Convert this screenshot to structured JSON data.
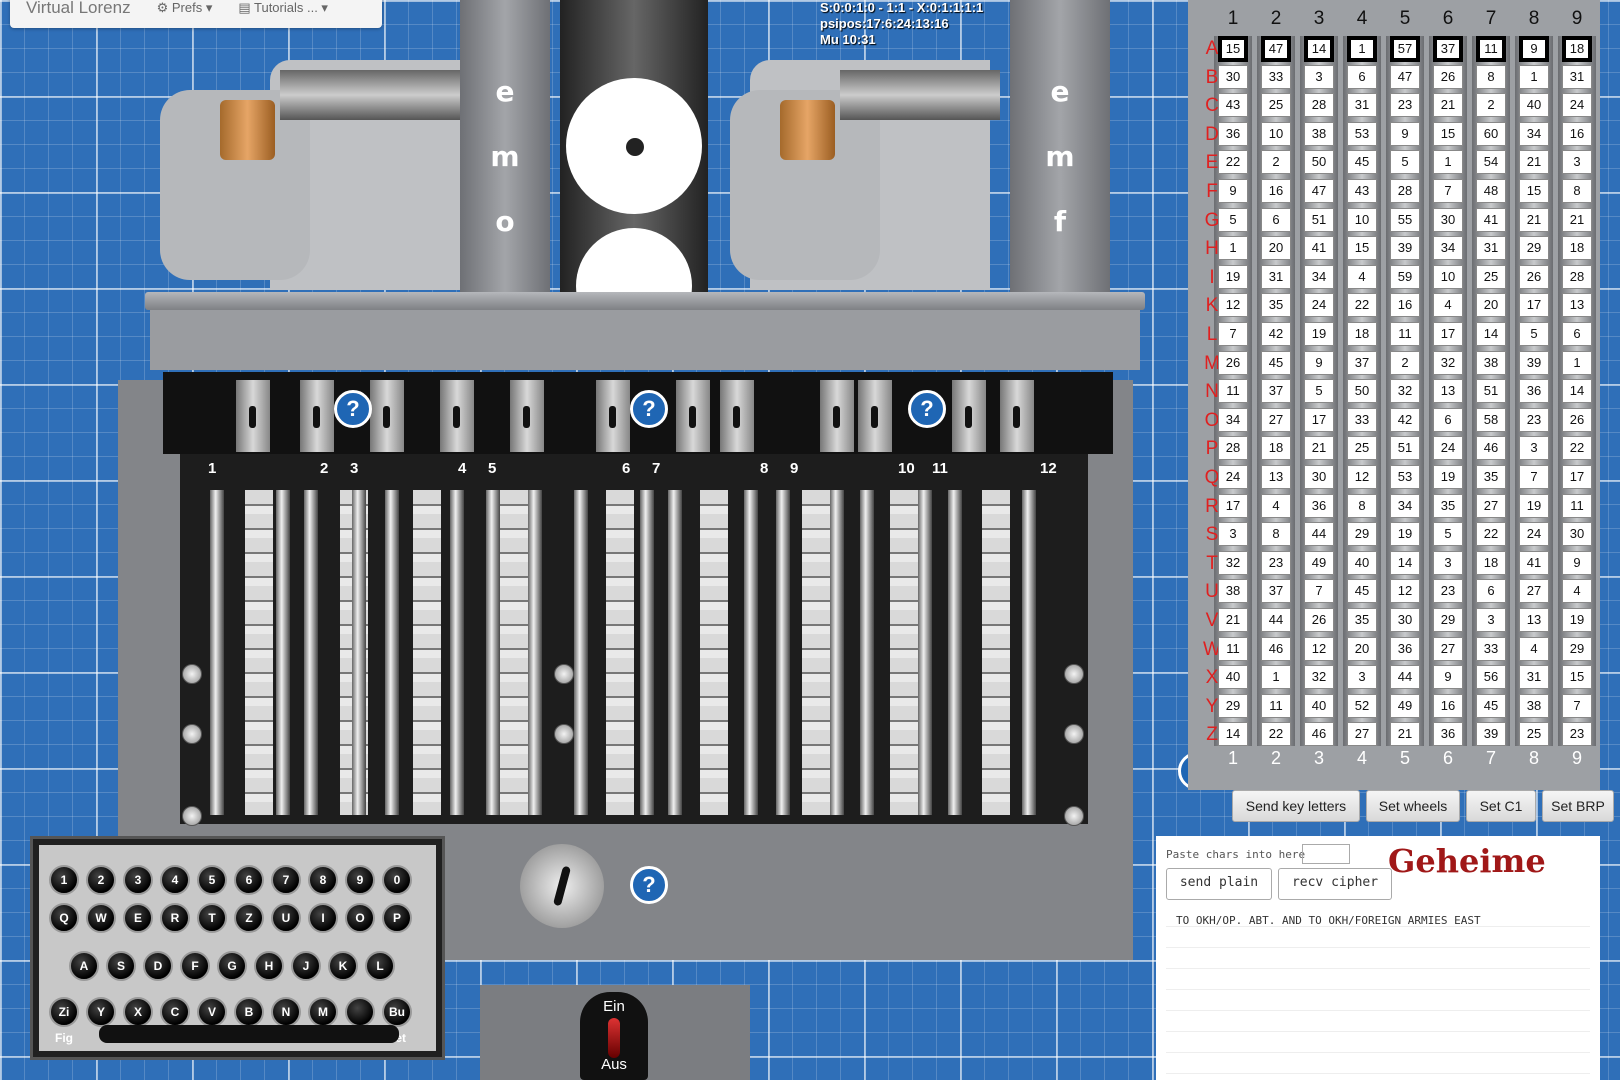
{
  "navbar": {
    "brand": "Virtual Lorenz",
    "prefs": "⚙ Prefs ▾",
    "tutorials": "▤ Tutorials ... ▾"
  },
  "status": {
    "line1": "S:0:0:1:0 - 1:1 - X:0:1:1:1:1",
    "line2": "psipos:17:6:24:13:16",
    "line3": "Mu 10:31"
  },
  "plates": {
    "left": [
      "e",
      "m",
      "o"
    ],
    "right": [
      "e",
      "m",
      "f"
    ]
  },
  "cam_wheel_labels": [
    "1",
    "2",
    "3",
    "4",
    "5",
    "6",
    "7",
    "8",
    "9",
    "10",
    "11",
    "12"
  ],
  "keyboard": {
    "row1": [
      "1",
      "2",
      "3",
      "4",
      "5",
      "6",
      "7",
      "8",
      "9",
      "0"
    ],
    "row2": [
      "Q",
      "W",
      "E",
      "R",
      "T",
      "Z",
      "U",
      "I",
      "O",
      "P"
    ],
    "row3": [
      "A",
      "S",
      "D",
      "F",
      "G",
      "H",
      "J",
      "K",
      "L"
    ],
    "row4": [
      "Zi Fig",
      "Y",
      "X",
      "C",
      "V",
      "B",
      "N",
      "M",
      "",
      "Bu Let"
    ]
  },
  "switch": {
    "on": "Ein",
    "off": "Aus"
  },
  "wheels": {
    "columns": [
      "1",
      "2",
      "3",
      "4",
      "5",
      "6",
      "7",
      "8",
      "9"
    ],
    "letters": [
      "A",
      "B",
      "C",
      "D",
      "E",
      "F",
      "G",
      "H",
      "I",
      "K",
      "L",
      "M",
      "N",
      "O",
      "P",
      "Q",
      "R",
      "S",
      "T",
      "U",
      "V",
      "W",
      "X",
      "Y",
      "Z"
    ],
    "rows": [
      [
        "15",
        "47",
        "14",
        "1",
        "57",
        "37",
        "11",
        "9",
        "18"
      ],
      [
        "30",
        "33",
        "3",
        "6",
        "47",
        "26",
        "8",
        "1",
        "31"
      ],
      [
        "43",
        "25",
        "28",
        "31",
        "23",
        "21",
        "2",
        "40",
        "24"
      ],
      [
        "36",
        "10",
        "38",
        "53",
        "9",
        "15",
        "60",
        "34",
        "16"
      ],
      [
        "22",
        "2",
        "50",
        "45",
        "5",
        "1",
        "54",
        "21",
        "3"
      ],
      [
        "9",
        "16",
        "47",
        "43",
        "28",
        "7",
        "48",
        "15",
        "8"
      ],
      [
        "5",
        "6",
        "51",
        "10",
        "55",
        "30",
        "41",
        "21",
        "21"
      ],
      [
        "1",
        "20",
        "41",
        "15",
        "39",
        "34",
        "31",
        "29",
        "18"
      ],
      [
        "19",
        "31",
        "34",
        "4",
        "59",
        "10",
        "25",
        "26",
        "28"
      ],
      [
        "12",
        "35",
        "24",
        "22",
        "16",
        "4",
        "20",
        "17",
        "13"
      ],
      [
        "7",
        "42",
        "19",
        "18",
        "11",
        "17",
        "14",
        "5",
        "6"
      ],
      [
        "26",
        "45",
        "9",
        "37",
        "2",
        "32",
        "38",
        "39",
        "1"
      ],
      [
        "11",
        "37",
        "5",
        "50",
        "32",
        "13",
        "51",
        "36",
        "14"
      ],
      [
        "34",
        "27",
        "17",
        "33",
        "42",
        "6",
        "58",
        "23",
        "26"
      ],
      [
        "28",
        "18",
        "21",
        "25",
        "51",
        "24",
        "46",
        "3",
        "22"
      ],
      [
        "24",
        "13",
        "30",
        "12",
        "53",
        "19",
        "35",
        "7",
        "17"
      ],
      [
        "17",
        "4",
        "36",
        "8",
        "34",
        "35",
        "27",
        "19",
        "11"
      ],
      [
        "3",
        "8",
        "44",
        "29",
        "19",
        "5",
        "22",
        "24",
        "30"
      ],
      [
        "32",
        "23",
        "49",
        "40",
        "14",
        "3",
        "18",
        "41",
        "9"
      ],
      [
        "38",
        "37",
        "7",
        "45",
        "12",
        "23",
        "6",
        "27",
        "4"
      ],
      [
        "21",
        "44",
        "26",
        "35",
        "30",
        "29",
        "3",
        "13",
        "19"
      ],
      [
        "11",
        "46",
        "12",
        "20",
        "36",
        "27",
        "33",
        "4",
        "29"
      ],
      [
        "40",
        "1",
        "32",
        "3",
        "44",
        "9",
        "56",
        "31",
        "15"
      ],
      [
        "29",
        "11",
        "40",
        "52",
        "49",
        "16",
        "45",
        "38",
        "7"
      ],
      [
        "14",
        "22",
        "46",
        "27",
        "21",
        "36",
        "39",
        "25",
        "23"
      ]
    ]
  },
  "actions": {
    "send_key": "Send key letters",
    "set_wheels": "Set wheels",
    "set_c1": "Set C1",
    "set_brp": "Set BRP"
  },
  "text_panel": {
    "paste_label": "Paste chars into here",
    "send_plain": "send plain",
    "recv_cipher": "recv cipher",
    "geheime": "Geheime",
    "output": "TO OKH/OP. ABT. AND TO OKH/FOREIGN ARMIES EAST"
  },
  "help": "?"
}
